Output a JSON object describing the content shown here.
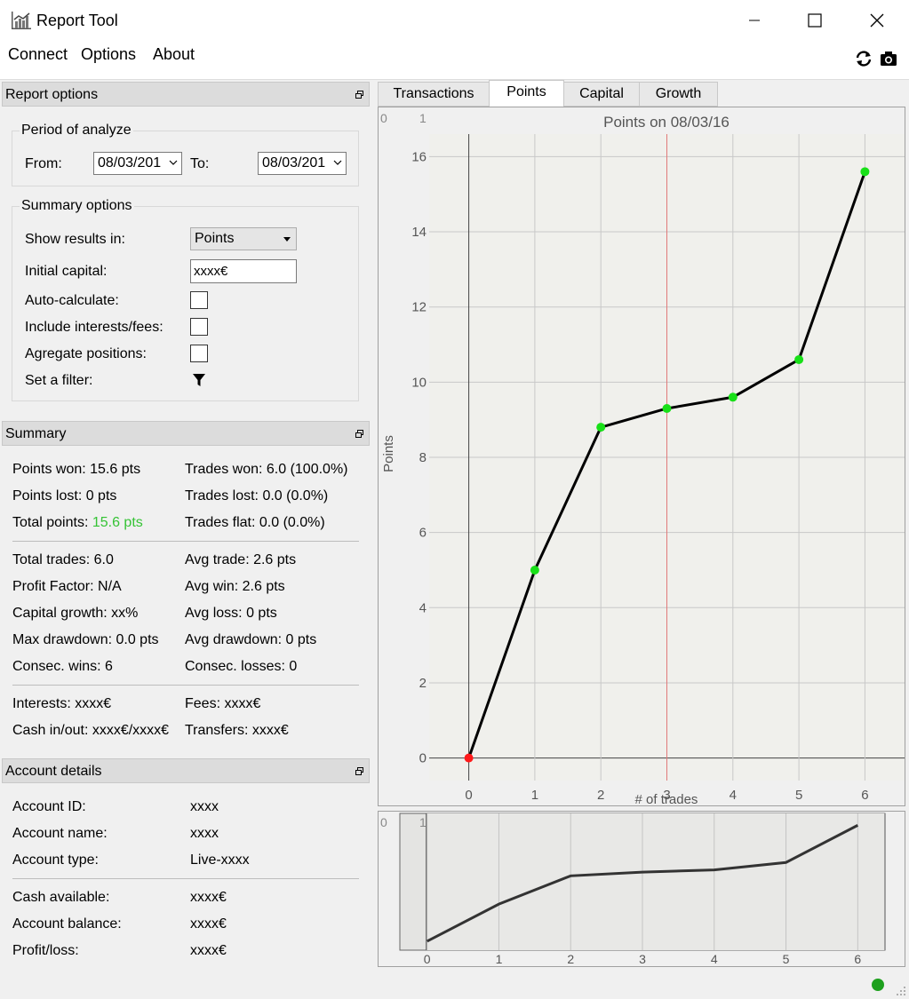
{
  "window": {
    "title": "Report Tool"
  },
  "menu": {
    "items": [
      "Connect",
      "Options",
      "About"
    ]
  },
  "toolbar": {
    "refresh_icon": "refresh-icon",
    "camera_icon": "camera-icon"
  },
  "report_options": {
    "header": "Report options",
    "period": {
      "title": "Period of analyze",
      "from_label": "From:",
      "from_value": "08/03/201",
      "to_label": "To:",
      "to_value": "08/03/201"
    },
    "summary_options": {
      "title": "Summary options",
      "show_results_label": "Show results in:",
      "show_results_value": "Points",
      "initial_capital_label": "Initial capital:",
      "initial_capital_value": "xxxx€",
      "auto_calculate_label": "Auto-calculate:",
      "include_interests_label": "Include interests/fees:",
      "aggregate_label": "Agregate positions:",
      "filter_label": "Set a filter:"
    }
  },
  "summary": {
    "header": "Summary",
    "points_won": "Points won: 15.6 pts",
    "trades_won": "Trades won: 6.0 (100.0%)",
    "points_lost": "Points lost: 0 pts",
    "trades_lost": "Trades lost: 0.0 (0.0%)",
    "total_points_label": "Total points:",
    "total_points_value": "15.6 pts",
    "trades_flat": "Trades flat: 0.0 (0.0%)",
    "total_trades": "Total trades: 6.0",
    "avg_trade": "Avg trade: 2.6 pts",
    "profit_factor": "Profit Factor: N/A",
    "avg_win": "Avg win: 2.6 pts",
    "capital_growth": "Capital growth: xx%",
    "avg_loss": "Avg loss: 0 pts",
    "max_drawdown": "Max drawdown: 0.0 pts",
    "avg_drawdown": "Avg drawdown: 0 pts",
    "consec_wins": "Consec. wins: 6",
    "consec_losses": "Consec. losses: 0",
    "interests": "Interests: xxxx€",
    "fees": "Fees: xxxx€",
    "cash_inout": "Cash in/out: xxxx€/xxxx€",
    "transfers": "Transfers: xxxx€"
  },
  "account": {
    "header": "Account details",
    "rows": [
      {
        "label": "Account ID:",
        "value": "xxxx"
      },
      {
        "label": "Account name:",
        "value": "xxxx"
      },
      {
        "label": "Account type:",
        "value": "Live-xxxx"
      },
      {
        "label": "Cash available:",
        "value": "xxxx€"
      },
      {
        "label": "Account balance:",
        "value": "xxxx€"
      },
      {
        "label": "Profit/loss:",
        "value": "xxxx€"
      }
    ]
  },
  "tabs": [
    {
      "label": "Transactions",
      "active": false
    },
    {
      "label": "Points",
      "active": true
    },
    {
      "label": "Capital",
      "active": false
    },
    {
      "label": "Growth",
      "active": false
    }
  ],
  "colors": {
    "positive": "#35c335",
    "marker_green": "#18e018",
    "marker_red": "#ff1a1a",
    "cursor_line": "#e07a7a",
    "status_ok": "#1ea01e"
  },
  "chart_data": [
    {
      "type": "line",
      "title": "Points on 08/03/16",
      "xlabel": "# of trades",
      "ylabel": "Points",
      "x": [
        0,
        1,
        2,
        3,
        4,
        5,
        6
      ],
      "series": [
        {
          "values": [
            0,
            5.0,
            8.8,
            9.3,
            9.6,
            10.6,
            15.6
          ]
        }
      ],
      "marker_colors": [
        "red",
        "green",
        "green",
        "green",
        "green",
        "green",
        "green"
      ],
      "xlim": [
        -0.6,
        6.6
      ],
      "ylim": [
        -0.6,
        16.6
      ],
      "xticks": [
        "0",
        "1",
        "2",
        "3",
        "4",
        "5",
        "6"
      ],
      "yticks": [
        "0",
        "2",
        "4",
        "6",
        "8",
        "10",
        "12",
        "14",
        "16"
      ],
      "cursor_x": 3,
      "grid": true,
      "corner_labels": [
        "0",
        "1"
      ]
    },
    {
      "type": "line",
      "x": [
        0,
        1,
        2,
        3,
        4,
        5,
        6
      ],
      "series": [
        {
          "values": [
            0,
            5.0,
            8.8,
            9.3,
            9.6,
            10.6,
            15.6
          ]
        }
      ],
      "xticks": [
        "0",
        "1",
        "2",
        "3",
        "4",
        "5",
        "6"
      ],
      "grid": true,
      "corner_labels": [
        "0",
        "1"
      ]
    }
  ]
}
